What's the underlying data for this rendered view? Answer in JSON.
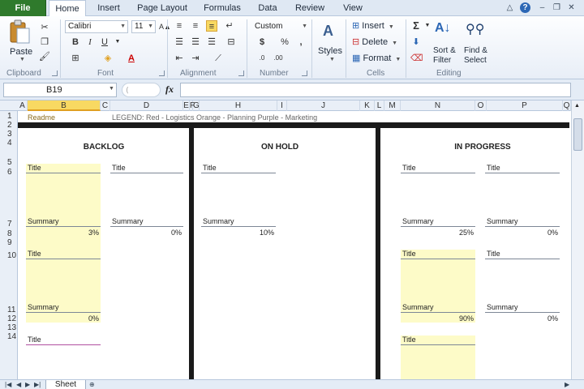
{
  "tabs": [
    "File",
    "Home",
    "Insert",
    "Page Layout",
    "Formulas",
    "Data",
    "Review",
    "View"
  ],
  "ribbon": {
    "clipboard": {
      "label": "Clipboard",
      "paste": "Paste"
    },
    "font": {
      "label": "Font",
      "name": "Calibri",
      "size": "11",
      "bold": "B",
      "italic": "I",
      "underline": "U"
    },
    "alignment": {
      "label": "Alignment"
    },
    "number": {
      "label": "Number",
      "format": "Custom",
      "currency": "$",
      "percent": "%",
      "comma": ","
    },
    "styles": {
      "label": "Styles"
    },
    "cells": {
      "label": "Cells",
      "insert": "Insert",
      "delete": "Delete",
      "format": "Format"
    },
    "editing": {
      "label": "Editing",
      "sort": "Sort &",
      "sort2": "Filter",
      "find": "Find &",
      "find2": "Select"
    }
  },
  "formula_bar": {
    "name_box": "B19",
    "fx": "fx",
    "value": ""
  },
  "columns": [
    "A",
    "B",
    "C",
    "D",
    "E",
    "F",
    "G",
    "H",
    "I",
    "J",
    "K",
    "L",
    "M",
    "N",
    "O",
    "P",
    "Q"
  ],
  "selected_column": "B",
  "rows": [
    "1",
    "2",
    "3",
    "4",
    "5",
    "6",
    "7",
    "8",
    "9",
    "10",
    "11",
    "12",
    "13",
    "14"
  ],
  "row1": {
    "readme": "Readme",
    "legend": "LEGEND: Red - Logistics    Orange - Planning    Purple - Marketing"
  },
  "board": {
    "columns": [
      {
        "heading": "BACKLOG"
      },
      {
        "heading": "ON HOLD"
      },
      {
        "heading": "IN PROGRESS"
      }
    ],
    "cards": [
      {
        "title": "Title",
        "summary": "Summary",
        "pct": "3%",
        "yellow": true
      },
      {
        "title": "Title",
        "summary": "Summary",
        "pct": "0%",
        "yellow": false
      },
      {
        "title": "Title",
        "summary": "Summary",
        "pct": "0%",
        "yellow": true
      },
      {
        "title": "Title",
        "yellow": false
      },
      {
        "title": "Title",
        "summary": "Summary",
        "pct": "10%",
        "yellow": false
      },
      {
        "title": "Title",
        "summary": "Summary",
        "pct": "25%",
        "yellow": false
      },
      {
        "title": "Title",
        "summary": "Summary",
        "pct": "0%",
        "yellow": false
      },
      {
        "title": "Title",
        "summary": "Summary",
        "pct": "90%",
        "yellow": true
      },
      {
        "title": "Title",
        "summary": "Summary",
        "pct": "0%",
        "yellow": false
      },
      {
        "title": "Title",
        "yellow": true
      }
    ]
  },
  "sheet_tabs": [
    "Sheet"
  ],
  "colors": {
    "file_tab": "#2f7a2c",
    "card_yellow": "#fdfbc8",
    "selection": "#f8d962",
    "divider": "#1a1a1a"
  }
}
